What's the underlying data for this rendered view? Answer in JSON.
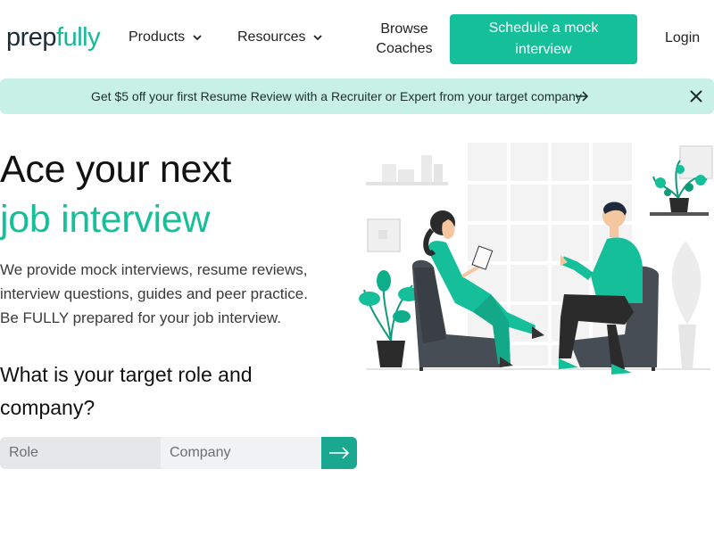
{
  "brand": {
    "logo_part1": "prep",
    "logo_part2": "fully"
  },
  "nav": {
    "products": "Products",
    "resources": "Resources",
    "browse_line1": "Browse",
    "browse_line2": "Coaches",
    "cta_line1": "Schedule a mock",
    "cta_line2": "interview",
    "login": "Login"
  },
  "banner": {
    "text": "Get $5 off your first Resume Review with a Recruiter or Expert from your target company",
    "arrow_icon": "arrow-right-icon",
    "close_icon": "close-icon",
    "bg_color": "#c7f1e6"
  },
  "hero": {
    "headline_line1": "Ace your next",
    "headline_line2": "job interview",
    "description_line1": "We provide mock interviews, resume reviews,",
    "description_line2": "interview questions, guides and peer practice.",
    "description_line3": "Be FULLY prepared for your job interview.",
    "question_line1": "What is your target role and",
    "question_line2": "company?"
  },
  "search": {
    "role_placeholder": "Role",
    "company_placeholder": "Company",
    "submit_icon": "arrow-right-icon"
  },
  "colors": {
    "accent": "#15bf9a",
    "accent_dark": "#1aa890"
  }
}
